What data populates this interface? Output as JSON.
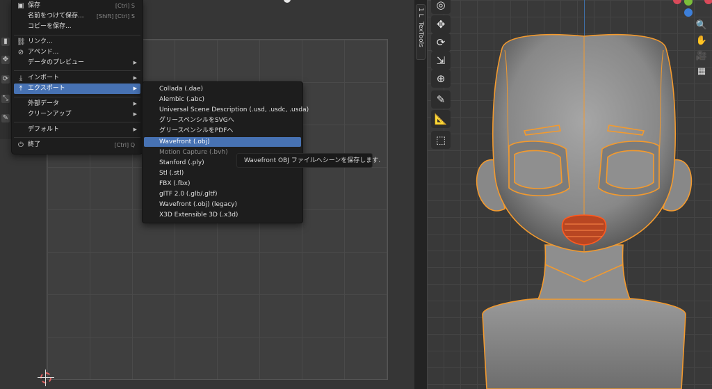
{
  "app": {
    "panel_tab": "TexTools",
    "panel_tab_mark": "1 L"
  },
  "file_menu": {
    "items": [
      {
        "id": "save",
        "icon": "save-icon",
        "glyph": "▣",
        "label": "保存",
        "shortcut": "[Ctrl] S"
      },
      {
        "id": "save-as",
        "icon": "",
        "glyph": "",
        "label": "名前をつけて保存...",
        "shortcut": "[Shift] [Ctrl] S"
      },
      {
        "id": "save-copy",
        "icon": "",
        "glyph": "",
        "label": "コピーを保存...",
        "shortcut": ""
      },
      {
        "id": "link",
        "icon": "link-icon",
        "glyph": "🔗",
        "label": "リンク...",
        "shortcut": ""
      },
      {
        "id": "append",
        "icon": "append-icon",
        "glyph": "📎",
        "label": "アペンド...",
        "shortcut": ""
      },
      {
        "id": "data-preview",
        "icon": "",
        "glyph": "",
        "label": "データのプレビュー",
        "shortcut": "",
        "submenu": true
      },
      {
        "id": "import",
        "icon": "import-icon",
        "glyph": "⤓",
        "label": "インポート",
        "shortcut": "",
        "submenu": true
      },
      {
        "id": "export",
        "icon": "export-icon",
        "glyph": "⤒",
        "label": "エクスポート",
        "shortcut": "",
        "submenu": true,
        "active": true
      },
      {
        "id": "external-data",
        "icon": "",
        "glyph": "",
        "label": "外部データ",
        "shortcut": "",
        "submenu": true
      },
      {
        "id": "clean-up",
        "icon": "",
        "glyph": "",
        "label": "クリーンアップ",
        "shortcut": "",
        "submenu": true
      },
      {
        "id": "defaults",
        "icon": "",
        "glyph": "",
        "label": "デフォルト",
        "shortcut": "",
        "submenu": true
      },
      {
        "id": "quit",
        "icon": "power-icon",
        "glyph": "⏻",
        "label": "終了",
        "shortcut": "[Ctrl] Q"
      }
    ]
  },
  "export_menu": {
    "items": [
      {
        "label": "Collada (.dae)"
      },
      {
        "label": "Alembic (.abc)"
      },
      {
        "label": "Universal Scene Description (.usd, .usdc, .usda)"
      },
      {
        "label": "グリースペンシルをSVGへ"
      },
      {
        "label": "グリースペンシルをPDFへ"
      },
      {
        "label": "Wavefront (.obj)",
        "active": true
      },
      {
        "label": "Motion Capture (.bvh)",
        "dim": true
      },
      {
        "label": "Stanford (.ply)"
      },
      {
        "label": "Stl (.stl)"
      },
      {
        "label": "FBX (.fbx)"
      },
      {
        "label": "glTF 2.0 (.glb/.gltf)"
      },
      {
        "label": "Wavefront (.obj) (legacy)"
      },
      {
        "label": "X3D Extensible 3D (.x3d)"
      }
    ]
  },
  "tooltip": {
    "text": "Wavefront OBJ ファイルへシーンを保存します."
  },
  "colors": {
    "accent": "#4772b3",
    "outline": "#f39a2e",
    "gizmo_x": "#d94a5a",
    "gizmo_y": "#7bbd3a",
    "gizmo_z": "#3d7fd9"
  },
  "viewport_tools": [
    "cursor-icon",
    "move-icon",
    "rotate-icon",
    "scale-icon",
    "transform-icon",
    "annotate-icon",
    "measure-icon",
    "add-cube-icon"
  ],
  "viewport_nav": [
    "zoom-icon",
    "hand-pan-icon",
    "camera-icon",
    "grid-view-icon"
  ]
}
